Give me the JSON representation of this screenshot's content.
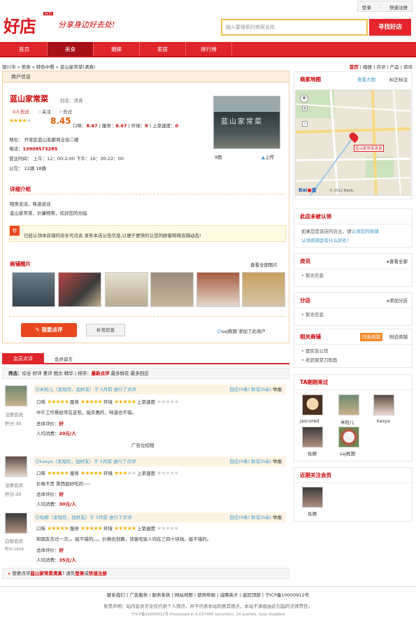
{
  "top": {
    "login": "登录",
    "register": "快速注册"
  },
  "logo": "好店",
  "beta": "BETA",
  "slogan": "分享身边好去处!",
  "search": {
    "placeholder": "输入要搜索的商家名称",
    "button": "寻找好店"
  },
  "nav": [
    "首页",
    "美食",
    "婚嫁",
    "家居",
    "排行榜"
  ],
  "breadcrumb": "银川市 » 美食 » 特色中餐 » 蓝山家常菜(清真)",
  "viewtabs": {
    "a": "首页",
    "b": "相册",
    "c": "点评",
    "d": "产品",
    "e": "资讯"
  },
  "shop": {
    "panel_title": "商户信息",
    "name": "蓝山家常菜",
    "alias": "别名：清真",
    "went": "0人去过",
    "follow": "关注",
    "wentlabel": "去过",
    "score": "8.45",
    "taste_l": "口味：",
    "taste": "8.67",
    "service_l": "服务：",
    "service": "8.67",
    "env_l": "环境：",
    "env": "8",
    "speed_l": "上菜速度：",
    "speed": "0",
    "addr": "地址： 开发区蓝山名郡商业街二楼",
    "tel_l": "电话：",
    "tel": "13909573285",
    "hours": "营业时间： 上午：12：00-2:00 下午：16：30-22：00",
    "bus": "公交： 22路 18路",
    "photo_count": "9图",
    "upload": "上传"
  },
  "detail": {
    "title": "详细介绍",
    "l1": "咽美无话，味道说话",
    "l2": "蓝山家常菜，价廉物美，欢迎您的光临"
  },
  "claim": {
    "badge": "荐",
    "text": "已经认领本店铺的店长可点此 发布本店公告信息,以便于更快的让您的顾客知晓店铺动态!"
  },
  "gallery": {
    "title": "商铺图片",
    "more": "查看全部图片"
  },
  "actions": {
    "review": "我要点评",
    "add_info": "补充信息",
    "user": "saj栋期",
    "added": "添加了此商户"
  },
  "tabs": {
    "a": "会员点评",
    "b": "会员留言"
  },
  "filter": {
    "label": "筛选：",
    "items": "综合 好评 差评 图文 精华",
    "sort": "排序：",
    "latest": "最新点评",
    "more": "最多鲜花 最多回应"
  },
  "reviews": [
    {
      "head": "米粒儿（发短信，加好友）于 5月前 进行了点评",
      "reply": "回应(0条)",
      "flower": "鲜花(0朵)",
      "report": "举报",
      "level": "注册会员",
      "points": "积分:30",
      "taste": "口味",
      "service": "服务",
      "env": "环境",
      "speed": "上菜速度",
      "text": "中午工作餐经常在这吃，挺实惠的，味道也不错。",
      "total": "总体评价：",
      "total_v": "好",
      "avg": "人均消费：",
      "avg_v": "20元/人"
    },
    {
      "head": "kasya（发短信，加好友）于 5月前 进行了点评",
      "reply": "回应(0条)",
      "flower": "鲜花(0朵)",
      "report": "举报",
      "level": "注册会员",
      "points": "积分:30",
      "taste": "口味",
      "service": "服务",
      "env": "环境",
      "speed": "上菜速度",
      "text": "价格不贵 茶西挺好吃的~~",
      "total": "总体评价：",
      "total_v": "好",
      "avg": "人均消费：",
      "avg_v": "30元/人"
    },
    {
      "head": "佐卿（发短信，加好友）于 5月前 进行了点评",
      "reply": "回应(0条)",
      "flower": "鲜花(0朵)",
      "report": "举报",
      "level": "白银会员",
      "points": "积分:1650",
      "taste": "口味",
      "service": "服务",
      "env": "环境",
      "speed": "上菜速度",
      "text": "和朋友去过一次。。挺不错的。。。价格也划算，该客吃饭人均在三四十块钱。挺不错的。",
      "total": "总体评价：",
      "total_v": "好",
      "avg": "人均消费：",
      "avg_v": "35元/人"
    }
  ],
  "ad": "广告位招租",
  "bottom": {
    "pre": "想要点评",
    "shop": "蓝山家常菜清真",
    "mid": "? 请先",
    "login": "登录",
    "or": "或",
    "reg": "快速注册"
  },
  "side": {
    "map": "商家地图",
    "bigmap": "查看大图",
    "fix": "纠正标注",
    "map_label": "蓝山家常菜清真",
    "map_copy": "© 2012 Baidu",
    "unclaimed": "此店未被认领",
    "unclaimed_l1": "如果您是该店的店主，请",
    "unclaimed_link": "认领您的商铺",
    "unclaimed_l2": "认领商铺会有什么好处?",
    "news": "资讯",
    "news_more": "查看全部",
    "news_none": "暂无信息",
    "branch": "分店",
    "branch_add": "添加分店",
    "branch_none": "暂无信息",
    "related": "相关商铺",
    "related_tag": "同类商铺",
    "related_near": "附近商铺",
    "rel1": "富民饭公馆",
    "rel2": "老武聚菜刀削面",
    "visitors": "TA刚刚来过",
    "v1": "jascored",
    "v2": "米粒儿",
    "v3": "kasya",
    "v4": "佐卿",
    "v5": "saj栋期",
    "followers": "近期关注会员",
    "f1": "佐卿"
  },
  "footer": {
    "links": "联系我们 | 广告服务 | 服务条款 | 网站地图 | 使用帮助 | 诚聘英才 | 返回顶部 | 宁ICP备10000912号",
    "disclaimer": "免责声明：站内会员言论仅代表个人观点，并不代表本站同意其观点，本站不承担由此引起的法律责任。",
    "stats": "宁ICP备10000912号  Processed in 0.037480 second(s), 14 queries, Gzip disabled"
  }
}
